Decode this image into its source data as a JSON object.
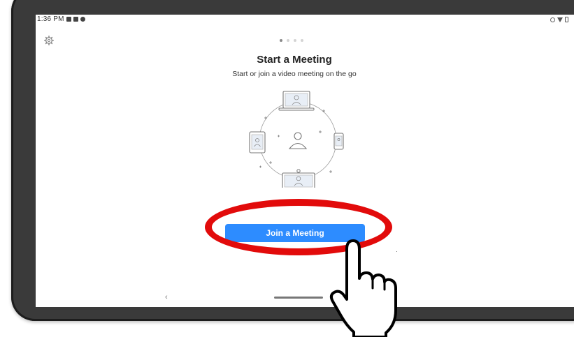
{
  "status_bar": {
    "time": "1:36 PM"
  },
  "onboarding": {
    "settings_icon": "gear-icon",
    "page_indicator": {
      "total": 4,
      "current": 1
    },
    "title": "Start a Meeting",
    "subtitle": "Start or join a video meeting on the go",
    "illustration": "video-meeting-devices-illustration",
    "join_button_label": "Join a Meeting"
  },
  "navigation_bar": {
    "back_icon": "back-chevron-icon",
    "back_glyph": "‹",
    "home_icon": "home-bar-icon"
  },
  "annotation": {
    "highlight_color": "#e20b0b",
    "pointer_icon": "pointing-hand-icon"
  },
  "colors": {
    "accent": "#2d8cff",
    "frame": "#3a3a3a"
  }
}
